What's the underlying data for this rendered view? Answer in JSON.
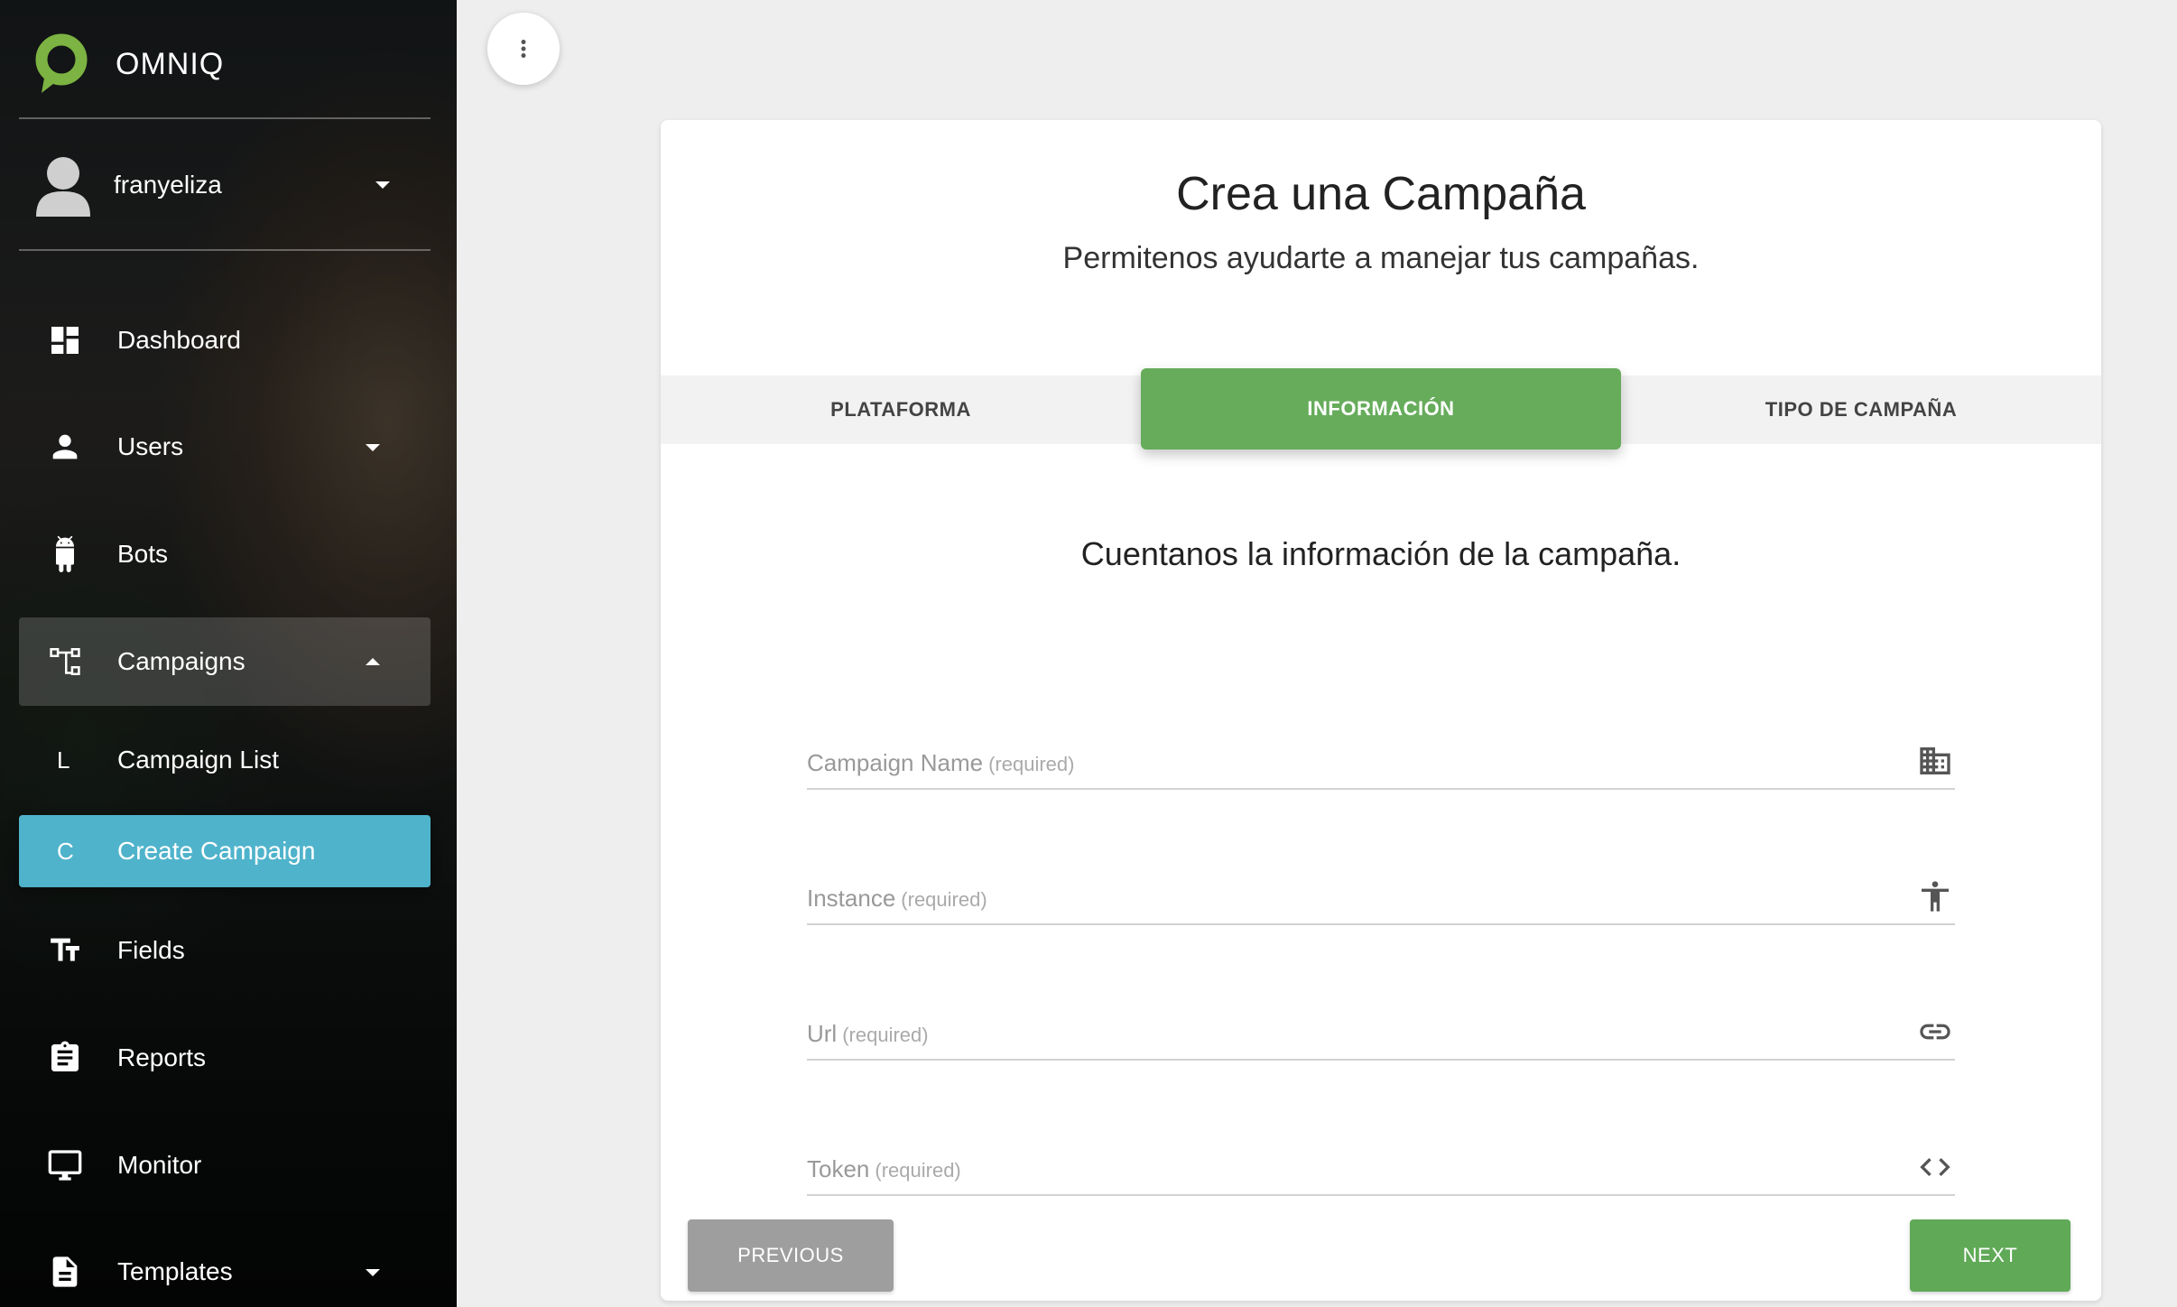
{
  "brand": {
    "name": "OMNIQ",
    "logo_color": "#7cb342"
  },
  "user": {
    "name": "franyeliza"
  },
  "sidebar": {
    "items": [
      {
        "label": "Dashboard",
        "icon": "dashboard-icon"
      },
      {
        "label": "Users",
        "icon": "person-icon",
        "has_submenu": true
      },
      {
        "label": "Bots",
        "icon": "android-icon"
      },
      {
        "label": "Campaigns",
        "icon": "hierarchy-icon",
        "has_submenu": true,
        "expanded": true
      },
      {
        "label": "Fields",
        "icon": "text-fields-icon"
      },
      {
        "label": "Reports",
        "icon": "clipboard-icon"
      },
      {
        "label": "Monitor",
        "icon": "monitor-icon"
      },
      {
        "label": "Templates",
        "icon": "document-icon",
        "has_submenu": true
      }
    ],
    "campaigns_sub": [
      {
        "mini": "L",
        "label": "Campaign List"
      },
      {
        "mini": "C",
        "label": "Create Campaign",
        "selected": true
      }
    ]
  },
  "card": {
    "title": "Crea una Campaña",
    "subtitle": "Permitenos ayudarte a manejar tus campañas."
  },
  "tabs": [
    {
      "label": "PLATAFORMA"
    },
    {
      "label": "INFORMACIÓN",
      "active": true
    },
    {
      "label": "TIPO DE CAMPAÑA"
    }
  ],
  "section_title": "Cuentanos la información de la campaña.",
  "form": {
    "fields": [
      {
        "label": "Campaign Name",
        "required": "(required)",
        "value": "",
        "icon": "building-icon"
      },
      {
        "label": "Instance",
        "required": "(required)",
        "value": "",
        "icon": "accessibility-icon"
      },
      {
        "label": "Url",
        "required": "(required)",
        "value": "",
        "icon": "link-icon"
      },
      {
        "label": "Token",
        "required": "(required)",
        "value": "",
        "icon": "code-icon"
      }
    ]
  },
  "buttons": {
    "previous": "PREVIOUS",
    "next": "NEXT"
  },
  "colors": {
    "accent_green": "#66ac5b",
    "selected_cyan": "#4fb3cb",
    "prev_gray": "#9e9e9e"
  }
}
